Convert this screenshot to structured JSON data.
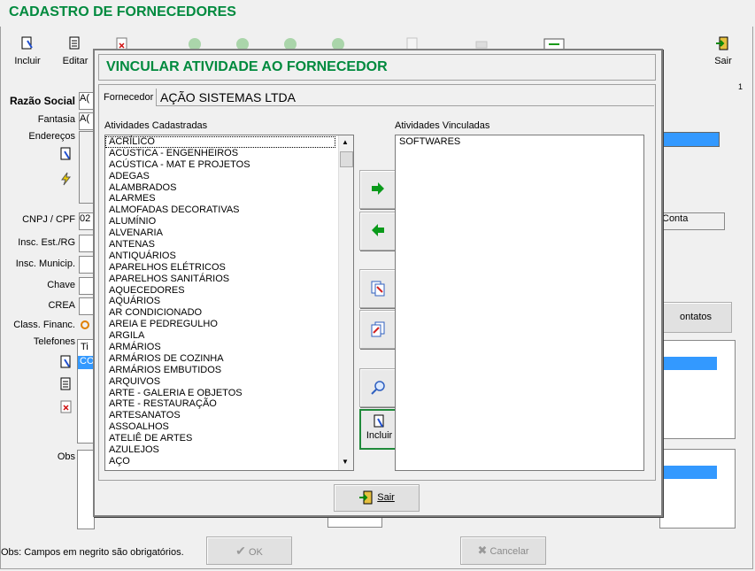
{
  "main": {
    "title": "CADASTRO DE FORNECEDORES",
    "toolbar": {
      "incluir": "Incluir",
      "editar": "Editar",
      "sair": "Sair"
    },
    "page_counter": "1",
    "form_labels": {
      "razao_social": "Razão Social",
      "fantasia": "Fantasia",
      "enderecos": "Endereços",
      "cnpj_cpf": "CNPJ / CPF",
      "insc_est": "Insc. Est./RG",
      "insc_munic": "Insc. Municip.",
      "chave": "Chave",
      "crea": "CREA",
      "class_financ": "Class. Financ.",
      "telefones": "Telefones",
      "obs": "Obs"
    },
    "partial_values": {
      "razao_social": "A(",
      "fantasia": "A(",
      "cnpj": "02",
      "tel_col": "Ti",
      "tel_row": "CO"
    },
    "right_labels": {
      "conta": "Conta",
      "contatos": "ontatos"
    },
    "status_text": "Obs: Campos em negrito são obrigatórios.",
    "ok_label": "OK",
    "cancelar_label": "Cancelar"
  },
  "dialog": {
    "title": "VINCULAR ATIVIDADE AO FORNECEDOR",
    "fornecedor_label": "Fornecedor",
    "fornecedor_value": "AÇÃO SISTEMAS LTDA",
    "cadastradas_label": "Atividades Cadastradas",
    "vinculadas_label": "Atividades Vinculadas",
    "cadastradas": [
      "ACRÍLICO",
      "ACÚSTICA - ENGENHEIROS",
      "ACÚSTICA - MAT E PROJETOS",
      "ADEGAS",
      "ALAMBRADOS",
      "ALARMES",
      "ALMOFADAS DECORATIVAS",
      "ALUMÍNIO",
      "ALVENARIA",
      "ANTENAS",
      "ANTIQUÁRIOS",
      "APARELHOS ELÉTRICOS",
      "APARELHOS SANITÁRIOS",
      "AQUECEDORES",
      "AQUÁRIOS",
      "AR CONDICIONADO",
      "AREIA E PEDREGULHO",
      "ARGILA",
      "ARMÁRIOS",
      "ARMÁRIOS DE COZINHA",
      "ARMÁRIOS EMBUTIDOS",
      "ARQUIVOS",
      "ARTE - GALERIA E OBJETOS",
      "ARTE - RESTAURAÇÃO",
      "ARTESANATOS",
      "ASSOALHOS",
      "ATELIÊ DE ARTES",
      "AZULEJOS",
      "AÇO"
    ],
    "vinculadas": [
      "SOFTWARES"
    ],
    "incluir_label": "Incluir",
    "sair_label": "Sair",
    "colors": {
      "accent_green": "#008a3e",
      "selection_blue": "#3399ff"
    }
  }
}
